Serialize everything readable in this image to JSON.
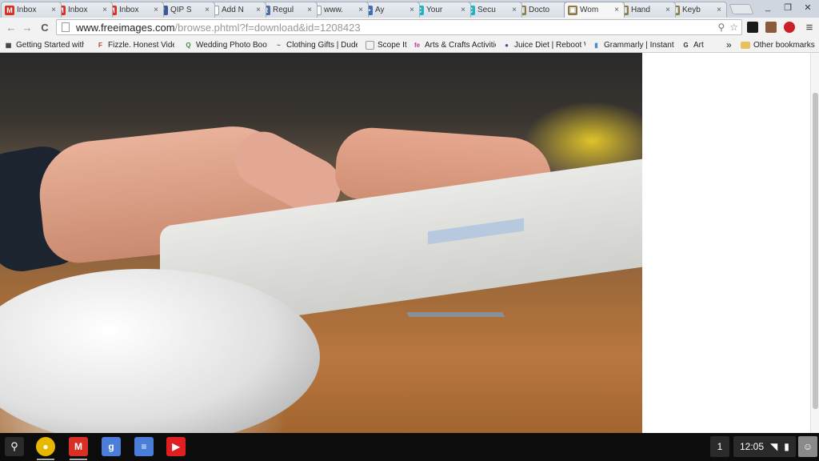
{
  "tabs": [
    {
      "label": "Inbox",
      "icon": "gmail-icon",
      "color": "#d93025",
      "glyph": "M"
    },
    {
      "label": "Inbox",
      "icon": "gmail-icon",
      "color": "#d93025",
      "glyph": "M"
    },
    {
      "label": "Inbox",
      "icon": "gmail-icon",
      "color": "#d93025",
      "glyph": "M"
    },
    {
      "label": "QIP S",
      "icon": "facebook-icon",
      "color": "#3b5998",
      "glyph": "f"
    },
    {
      "label": "Add N",
      "icon": "page-icon",
      "color": "#ffffff",
      "glyph": ""
    },
    {
      "label": "Regul",
      "icon": "regul-icon",
      "color": "#4a6fa5",
      "glyph": "R"
    },
    {
      "label": "www.",
      "icon": "page-icon",
      "color": "#ffffff",
      "glyph": ""
    },
    {
      "label": "Ay",
      "icon": "play-icon",
      "color": "#3b6fb6",
      "glyph": "▶"
    },
    {
      "label": "Your",
      "icon": "circle-c-icon",
      "color": "#1fb5c4",
      "glyph": "C"
    },
    {
      "label": "Secu",
      "icon": "circle-c-icon",
      "color": "#1fb5c4",
      "glyph": "C"
    },
    {
      "label": "Docto",
      "icon": "image-icon",
      "color": "#8a7a4a",
      "glyph": "▣"
    },
    {
      "label": "Wom",
      "icon": "image-icon",
      "color": "#8a7a4a",
      "glyph": "▣",
      "active": true
    },
    {
      "label": "Hand",
      "icon": "image-icon",
      "color": "#8a7a4a",
      "glyph": "▣"
    },
    {
      "label": "Keyb",
      "icon": "image-icon",
      "color": "#8a7a4a",
      "glyph": "▣"
    }
  ],
  "tab_close_glyph": "×",
  "window_controls": {
    "minimize": "_",
    "restore": "❐",
    "close": "✕"
  },
  "toolbar": {
    "back": "←",
    "forward": "→",
    "reload": "C",
    "url_host": "www.freeimages.com",
    "url_path": "/browse.phtml?f=download&id=1208423",
    "search_glyph": "⚲",
    "star_glyph": "☆",
    "menu_glyph": "≡"
  },
  "extensions": [
    {
      "name": "shield-extension-icon",
      "color": "#1a1a1a"
    },
    {
      "name": "instagram-extension-icon",
      "color": "#8a5a3a"
    },
    {
      "name": "pinterest-extension-icon",
      "color": "#cb2027"
    }
  ],
  "bookmarks": [
    {
      "label": "Getting Started with",
      "icon": "bookmark-app-icon",
      "color": "#333333",
      "glyph": "▦"
    },
    {
      "label": "Fizzle. Honest Video",
      "icon": "fizzle-icon",
      "color": "#c0392b",
      "glyph": "F"
    },
    {
      "label": "Wedding Photo Book",
      "icon": "qk-icon",
      "color": "#3c8d3c",
      "glyph": "Q"
    },
    {
      "label": "Clothing Gifts | Dude",
      "icon": "mustache-icon",
      "color": "#6b5a1a",
      "glyph": "~"
    },
    {
      "label": "Scope It",
      "icon": "page-icon",
      "color": "#ffffff",
      "glyph": ""
    },
    {
      "label": "Arts & Crafts Activitie",
      "icon": "fe-icon",
      "color": "#c0399b",
      "glyph": "fe"
    },
    {
      "label": "Juice Diet | Reboot W",
      "icon": "juice-icon",
      "color": "#6b3a8a",
      "glyph": "●"
    },
    {
      "label": "Grammarly | Instant E",
      "icon": "grammarly-icon",
      "color": "#4a8ac4",
      "glyph": "▮"
    },
    {
      "label": "Art",
      "icon": "g-icon",
      "color": "#333333",
      "glyph": "G"
    }
  ],
  "bookmarks_overflow": "»",
  "other_bookmarks": "Other bookmarks",
  "shelf": {
    "launcher_glyph": "⚲",
    "apps": [
      {
        "name": "chrome-app-icon",
        "color": "#e8b700",
        "glyph": "●"
      },
      {
        "name": "gmail-app-icon",
        "color": "#d93025",
        "glyph": "M"
      },
      {
        "name": "google-plus-app-icon",
        "color": "#4a7ed8",
        "glyph": "g"
      },
      {
        "name": "docs-app-icon",
        "color": "#4a7ed8",
        "glyph": "≡"
      },
      {
        "name": "youtube-app-icon",
        "color": "#e02020",
        "glyph": "▶"
      }
    ],
    "notification_count": "1",
    "time": "12:05",
    "wifi_glyph": "◥",
    "battery_glyph": "▮"
  }
}
